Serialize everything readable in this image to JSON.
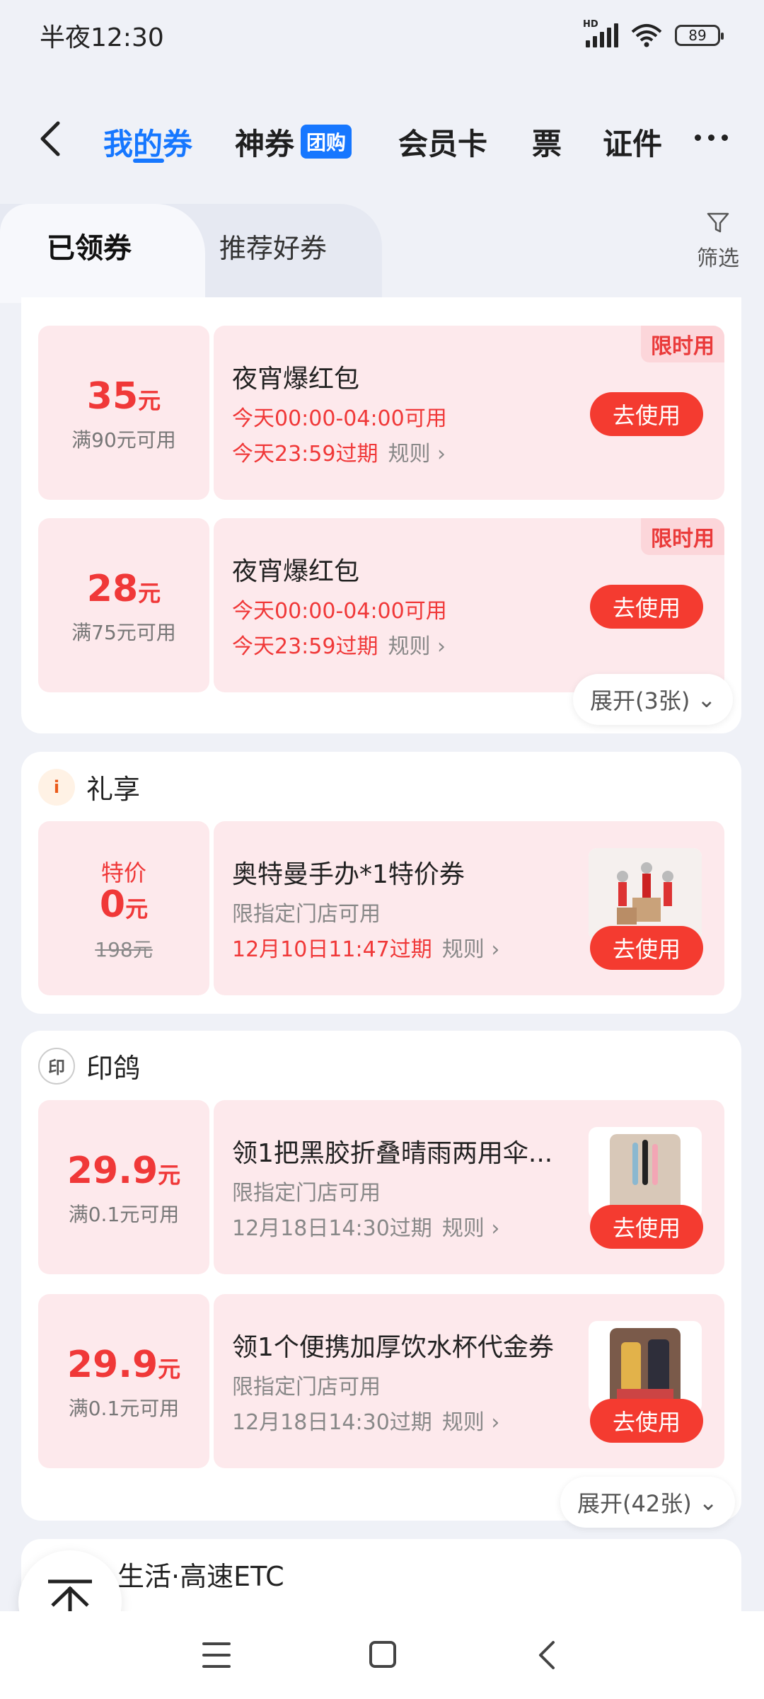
{
  "status": {
    "time": "半夜12:30",
    "network": "HD",
    "battery": "89"
  },
  "nav": {
    "tabs": [
      {
        "label": "我的券",
        "active": true
      },
      {
        "label": "神券",
        "badge": "团购"
      },
      {
        "label": "会员卡"
      },
      {
        "label": "票"
      },
      {
        "label": "证件"
      }
    ]
  },
  "subtabs": {
    "active": "已领券",
    "other": "推荐好券",
    "filter": "筛选"
  },
  "colors": {
    "accent": "#1677ff",
    "primary_red": "#f43b30",
    "coupon_bg": "#fde9ec"
  },
  "groups": [
    {
      "store": "",
      "coupons": [
        {
          "amount": "35",
          "unit": "元",
          "condition": "满90元可用",
          "title": "夜宵爆红包",
          "line2": "今天00:00-04:00可用",
          "line3": "今天23:59过期",
          "rule": "规则",
          "tag": "限时用",
          "button": "去使用"
        },
        {
          "amount": "28",
          "unit": "元",
          "condition": "满75元可用",
          "title": "夜宵爆红包",
          "line2": "今天00:00-04:00可用",
          "line3": "今天23:59过期",
          "rule": "规则",
          "tag": "限时用",
          "button": "去使用"
        }
      ],
      "expand": "展开(3张)"
    },
    {
      "store": "礼享",
      "coupons": [
        {
          "special": "特价",
          "amount": "0",
          "unit": "元",
          "original": "198元",
          "title": "奥特曼手办*1特价券",
          "line2": "限指定门店可用",
          "line3": "12月10日11:47过期",
          "rule": "规则",
          "button": "去使用",
          "thumb": "ultraman-figure-image"
        }
      ]
    },
    {
      "store": "印鸽",
      "coupons": [
        {
          "amount": "29.9",
          "unit": "元",
          "condition": "满0.1元可用",
          "title": "领1把黑胶折叠晴雨两用伞...",
          "line2": "限指定门店可用",
          "line3": "12月18日14:30过期",
          "rule": "规则",
          "button": "去使用",
          "thumb": "umbrella-image"
        },
        {
          "amount": "29.9",
          "unit": "元",
          "condition": "满0.1元可用",
          "title": "领1个便携加厚饮水杯代金券",
          "line2": "限指定门店可用",
          "line3": "12月18日14:30过期",
          "rule": "规则",
          "button": "去使用",
          "thumb": "water-cup-image"
        }
      ],
      "expand": "展开(42张)"
    },
    {
      "store": "生活·高速ETC"
    }
  ]
}
